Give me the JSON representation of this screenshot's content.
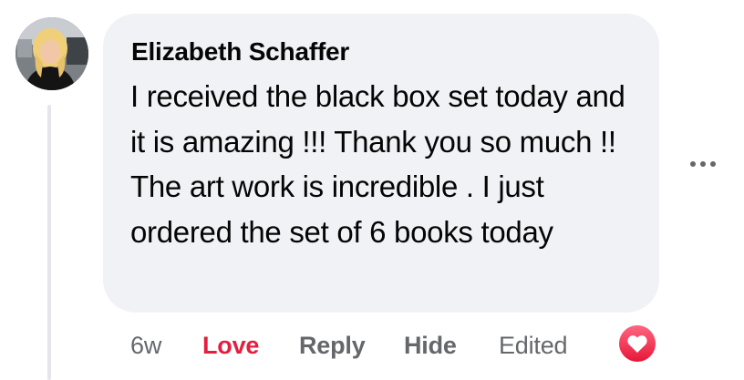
{
  "comment": {
    "author": "Elizabeth Schaffer",
    "text": "I received the black box set today and it is amazing !!! Thank you so much !! The art work is incredible . I just ordered the set of 6 books today",
    "avatar_icon": "user-photo"
  },
  "actions": {
    "time": "6w",
    "love_label": "Love",
    "reply_label": "Reply",
    "hide_label": "Hide",
    "edited_label": "Edited"
  },
  "reaction": {
    "icon": "heart-reaction-icon",
    "color": "#f33e58"
  },
  "colors": {
    "bubble_bg": "#f0f2f5",
    "text": "#050505",
    "secondary": "#65676b",
    "love_active": "#e41e3f"
  }
}
